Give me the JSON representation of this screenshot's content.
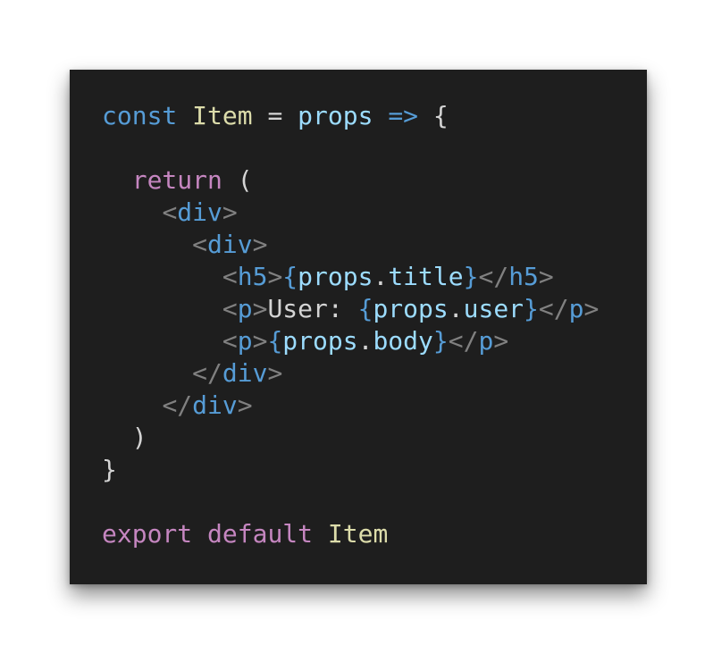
{
  "colors": {
    "background": "#1e1e1e",
    "keyword": "#569cd6",
    "control": "#c586c0",
    "component": "#dcdcaa",
    "variable": "#9cdcfe",
    "punctuation": "#d4d4d4",
    "tag_bracket": "#808080",
    "tag_name": "#569cd6"
  },
  "code": {
    "lines": [
      [
        {
          "text": "const",
          "type": "keyword"
        },
        {
          "text": " ",
          "type": "text"
        },
        {
          "text": "Item",
          "type": "component"
        },
        {
          "text": " = ",
          "type": "punct"
        },
        {
          "text": "props",
          "type": "variable"
        },
        {
          "text": " ",
          "type": "text"
        },
        {
          "text": "=>",
          "type": "keyword"
        },
        {
          "text": " {",
          "type": "punct"
        }
      ],
      [],
      [
        {
          "text": "  ",
          "type": "text"
        },
        {
          "text": "return",
          "type": "control"
        },
        {
          "text": " (",
          "type": "punct"
        }
      ],
      [
        {
          "text": "    ",
          "type": "text"
        },
        {
          "text": "<",
          "type": "bracket"
        },
        {
          "text": "div",
          "type": "tag"
        },
        {
          "text": ">",
          "type": "bracket"
        }
      ],
      [
        {
          "text": "      ",
          "type": "text"
        },
        {
          "text": "<",
          "type": "bracket"
        },
        {
          "text": "div",
          "type": "tag"
        },
        {
          "text": ">",
          "type": "bracket"
        }
      ],
      [
        {
          "text": "        ",
          "type": "text"
        },
        {
          "text": "<",
          "type": "bracket"
        },
        {
          "text": "h5",
          "type": "tag"
        },
        {
          "text": ">",
          "type": "bracket"
        },
        {
          "text": "{",
          "type": "keyword"
        },
        {
          "text": "props",
          "type": "variable"
        },
        {
          "text": ".",
          "type": "punct"
        },
        {
          "text": "title",
          "type": "variable"
        },
        {
          "text": "}",
          "type": "keyword"
        },
        {
          "text": "</",
          "type": "bracket"
        },
        {
          "text": "h5",
          "type": "tag"
        },
        {
          "text": ">",
          "type": "bracket"
        }
      ],
      [
        {
          "text": "        ",
          "type": "text"
        },
        {
          "text": "<",
          "type": "bracket"
        },
        {
          "text": "p",
          "type": "tag"
        },
        {
          "text": ">",
          "type": "bracket"
        },
        {
          "text": "User: ",
          "type": "text"
        },
        {
          "text": "{",
          "type": "keyword"
        },
        {
          "text": "props",
          "type": "variable"
        },
        {
          "text": ".",
          "type": "punct"
        },
        {
          "text": "user",
          "type": "variable"
        },
        {
          "text": "}",
          "type": "keyword"
        },
        {
          "text": "</",
          "type": "bracket"
        },
        {
          "text": "p",
          "type": "tag"
        },
        {
          "text": ">",
          "type": "bracket"
        }
      ],
      [
        {
          "text": "        ",
          "type": "text"
        },
        {
          "text": "<",
          "type": "bracket"
        },
        {
          "text": "p",
          "type": "tag"
        },
        {
          "text": ">",
          "type": "bracket"
        },
        {
          "text": "{",
          "type": "keyword"
        },
        {
          "text": "props",
          "type": "variable"
        },
        {
          "text": ".",
          "type": "punct"
        },
        {
          "text": "body",
          "type": "variable"
        },
        {
          "text": "}",
          "type": "keyword"
        },
        {
          "text": "</",
          "type": "bracket"
        },
        {
          "text": "p",
          "type": "tag"
        },
        {
          "text": ">",
          "type": "bracket"
        }
      ],
      [
        {
          "text": "      ",
          "type": "text"
        },
        {
          "text": "</",
          "type": "bracket"
        },
        {
          "text": "div",
          "type": "tag"
        },
        {
          "text": ">",
          "type": "bracket"
        }
      ],
      [
        {
          "text": "    ",
          "type": "text"
        },
        {
          "text": "</",
          "type": "bracket"
        },
        {
          "text": "div",
          "type": "tag"
        },
        {
          "text": ">",
          "type": "bracket"
        }
      ],
      [
        {
          "text": "  ",
          "type": "text"
        },
        {
          "text": ")",
          "type": "punct"
        }
      ],
      [
        {
          "text": "}",
          "type": "punct"
        }
      ],
      [],
      [
        {
          "text": "export",
          "type": "control"
        },
        {
          "text": " ",
          "type": "text"
        },
        {
          "text": "default",
          "type": "control"
        },
        {
          "text": " ",
          "type": "text"
        },
        {
          "text": "Item",
          "type": "component"
        }
      ]
    ]
  }
}
